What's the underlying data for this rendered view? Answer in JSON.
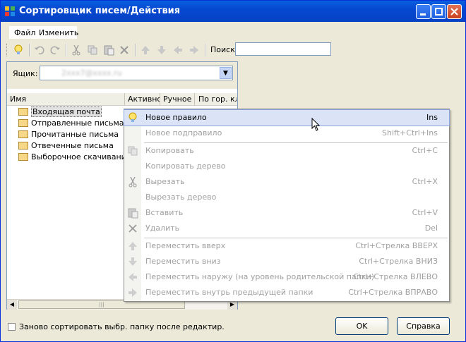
{
  "window": {
    "title": "Сортировщик писем/Действия"
  },
  "menu": {
    "file": "Файл",
    "edit": "Изменить"
  },
  "toolbar": {
    "search_label": "Поиск",
    "search_value": ""
  },
  "mailbox": {
    "label": "Ящик:",
    "value": "2xxx7@xxxx.ru"
  },
  "columns": [
    "Имя",
    "Активно",
    "Ручное",
    "По гор. кла"
  ],
  "folders": [
    {
      "label": "Входящая почта",
      "selected": true
    },
    {
      "label": "Отправленные письма"
    },
    {
      "label": "Прочитанные письма"
    },
    {
      "label": "Отвеченные письма"
    },
    {
      "label": "Выборочное скачивание"
    }
  ],
  "context_menu": {
    "items": [
      {
        "label": "Новое правило",
        "shortcut": "Ins",
        "disabled": false,
        "icon": "new-rule-icon"
      },
      {
        "label": "Новое подправило",
        "shortcut": "Shift+Ctrl+Ins",
        "disabled": true
      },
      {
        "label": "Копировать",
        "shortcut": "Ctrl+C",
        "disabled": true,
        "icon": "copy-icon"
      },
      {
        "label": "Копировать дерево",
        "shortcut": "",
        "disabled": true
      },
      {
        "label": "Вырезать",
        "shortcut": "Ctrl+X",
        "disabled": true,
        "icon": "scissors-icon"
      },
      {
        "label": "Вырезать дерево",
        "shortcut": "",
        "disabled": true
      },
      {
        "label": "Вставить",
        "shortcut": "Ctrl+V",
        "disabled": true,
        "icon": "paste-icon"
      },
      {
        "label": "Удалить",
        "shortcut": "Del",
        "disabled": true,
        "icon": "delete-icon"
      },
      {
        "label": "Переместить вверх",
        "shortcut": "Ctrl+Стрелка ВВЕРХ",
        "disabled": true,
        "icon": "arrow-up-icon"
      },
      {
        "label": "Переместить вниз",
        "shortcut": "Ctrl+Стрелка ВНИЗ",
        "disabled": true,
        "icon": "arrow-down-icon"
      },
      {
        "label": "Переместить наружу (на уровень родительской папки)",
        "shortcut": "Ctrl+Стрелка ВЛЕВО",
        "disabled": true,
        "icon": "arrow-left-icon"
      },
      {
        "label": "Переместить внутрь предыдущей папки",
        "shortcut": "Ctrl+Стрелка ВПРАВО",
        "disabled": true,
        "icon": "arrow-right-icon"
      }
    ]
  },
  "footer": {
    "checkbox_label": "Заново сортировать выбр. папку после редактир.",
    "ok": "OK",
    "help": "Справка"
  },
  "colors": {
    "titlebar": "#0548d0",
    "face": "#ece9d8",
    "highlight": "#dbe4f7"
  }
}
